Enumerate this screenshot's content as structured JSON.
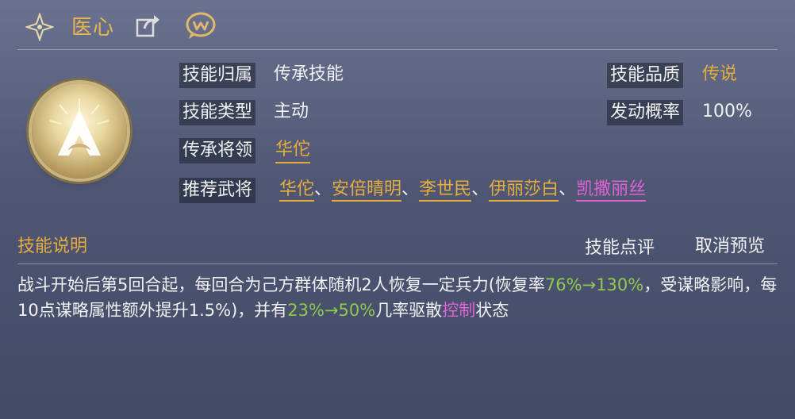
{
  "header": {
    "title": "医心",
    "star_icon": "four-point-star-icon",
    "share_icon": "share-icon",
    "chat_icon": "chat-icon"
  },
  "skill": {
    "icon": "skill-emblem-icon",
    "attribution_label": "技能归属",
    "attribution_value": "传承技能",
    "type_label": "技能类型",
    "type_value": "主动",
    "inherit_general_label": "传承将领",
    "inherit_general_value": "华佗",
    "recommended_label": "推荐武将",
    "recommended": [
      "华佗",
      "安倍晴明",
      "李世民",
      "伊丽莎白",
      "凯撒丽丝"
    ],
    "separator": "、",
    "quality_label": "技能品质",
    "quality_value": "传说",
    "trigger_rate_label": "发动概率",
    "trigger_rate_value": "100%"
  },
  "section": {
    "title": "技能说明",
    "review_button": "技能点评",
    "cancel_preview_button": "取消预览"
  },
  "description": {
    "p1": "战斗开始后第5回合起，每回合为己方群体随机2人恢复一定兵力(恢复率",
    "p2_green": "76%→130%",
    "p3": "，受谋略影响，每10点谋略属性额外提升1.5%)，并有",
    "p4_green": "23%→50%",
    "p5": "几率驱散",
    "p6_pink": "控制",
    "p7": "状态"
  },
  "colors": {
    "gold": "#e6ad3c",
    "green": "#8ecb4d",
    "pink": "#e063d6"
  }
}
